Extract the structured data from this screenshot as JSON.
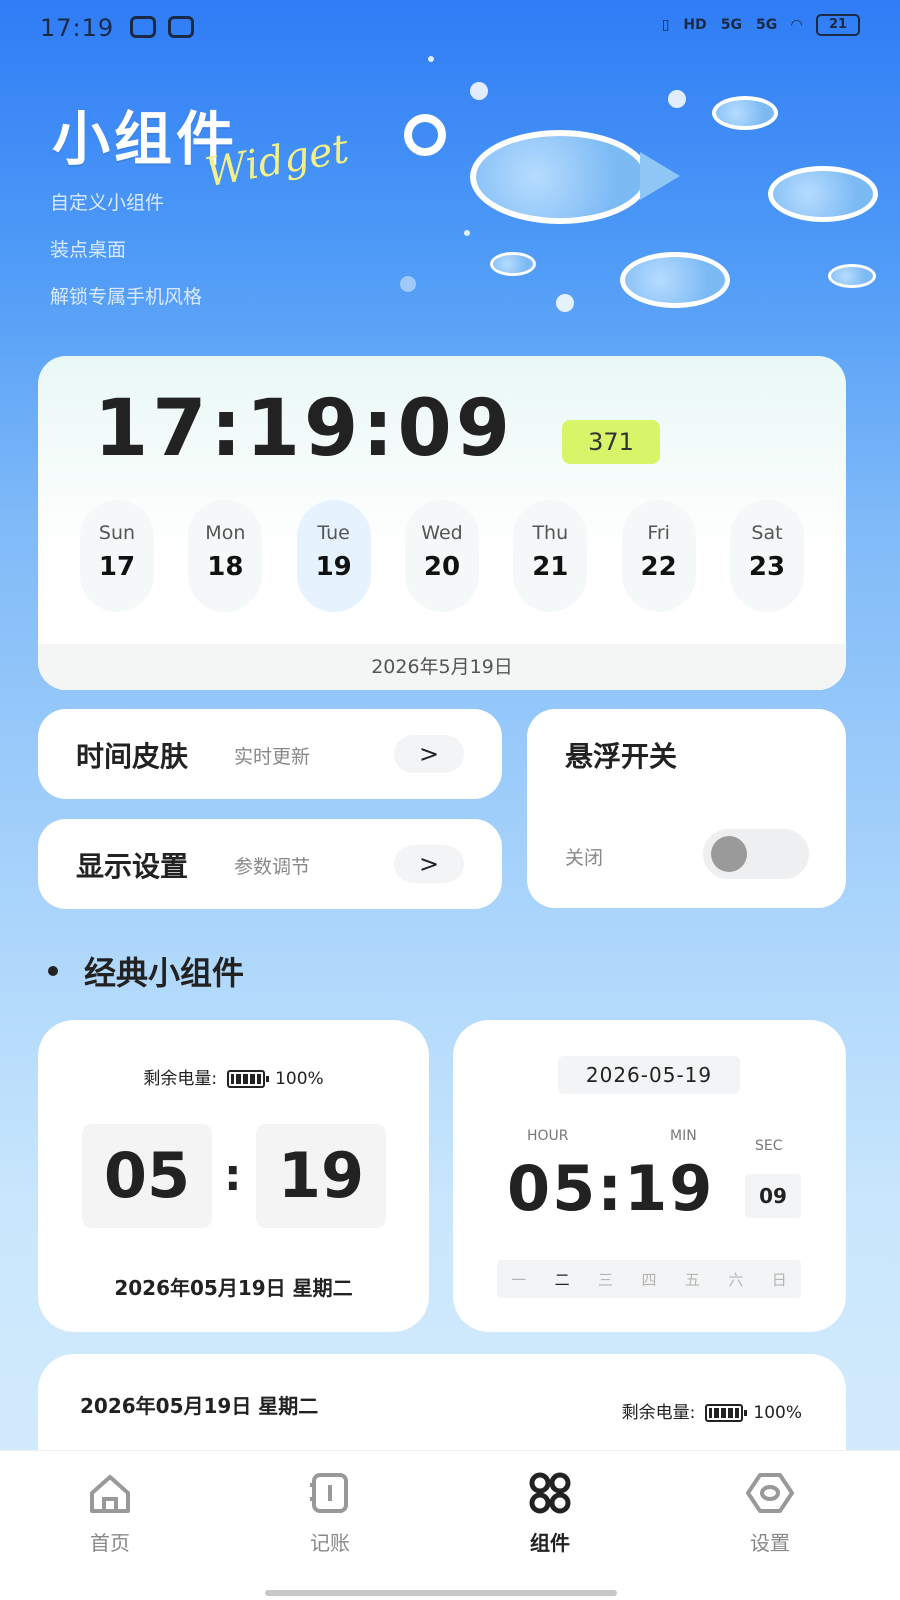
{
  "status_bar": {
    "time": "17:19",
    "network_1": "5G",
    "network_2": "5G",
    "battery": "21"
  },
  "hero": {
    "title": "小组件",
    "script": "Widget",
    "lines": [
      "自定义小组件",
      "装点桌面",
      "解锁专属手机风格"
    ]
  },
  "clock_card": {
    "time": "17:19:09",
    "badge": "371",
    "days": [
      {
        "name": "Sun",
        "num": "17"
      },
      {
        "name": "Mon",
        "num": "18"
      },
      {
        "name": "Tue",
        "num": "19",
        "active": true
      },
      {
        "name": "Wed",
        "num": "20"
      },
      {
        "name": "Thu",
        "num": "21"
      },
      {
        "name": "Fri",
        "num": "22"
      },
      {
        "name": "Sat",
        "num": "23"
      }
    ],
    "date": "2026年5月19日"
  },
  "settings": {
    "skin": {
      "title": "时间皮肤",
      "sub": "实时更新",
      "arrow": ">"
    },
    "display": {
      "title": "显示设置",
      "sub": "参数调节",
      "arrow": ">"
    },
    "float": {
      "title": "悬浮开关",
      "status": "关闭",
      "on": false
    }
  },
  "section": {
    "title": "经典小组件"
  },
  "widget1": {
    "battery_label": "剩余电量:",
    "battery_value": "100%",
    "hour": "05",
    "colon": ":",
    "minute": "19",
    "date": "2026年05月19日 星期二"
  },
  "widget2": {
    "date": "2026-05-19",
    "hour_label": "HOUR",
    "min_label": "MIN",
    "sec_label": "SEC",
    "time": "05:19",
    "sec": "09",
    "weekdays": [
      "一",
      "二",
      "三",
      "四",
      "五",
      "六",
      "日"
    ],
    "current_weekday": "二"
  },
  "widget3": {
    "date": "2026年05月19日 星期二",
    "battery_label": "剩余电量:",
    "battery_value": "100%"
  },
  "nav": {
    "items": [
      {
        "label": "首页",
        "icon": "home-icon"
      },
      {
        "label": "记账",
        "icon": "ledger-icon"
      },
      {
        "label": "组件",
        "icon": "widgets-icon",
        "active": true
      },
      {
        "label": "设置",
        "icon": "settings-icon"
      }
    ]
  }
}
